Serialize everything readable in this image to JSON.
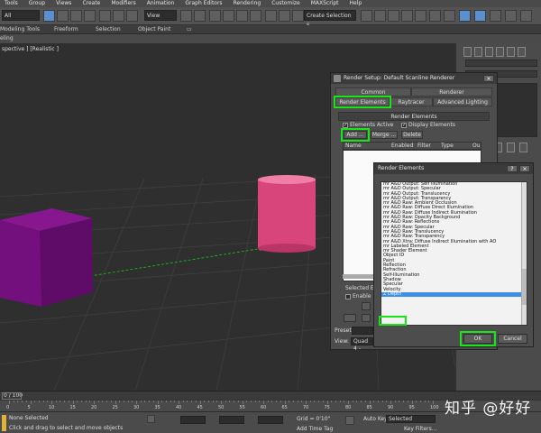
{
  "menu": [
    "Tools",
    "Group",
    "Views",
    "Create",
    "Modifiers",
    "Animation",
    "Graph Editors",
    "Rendering",
    "Customize",
    "MAXScript",
    "Help"
  ],
  "toolbar": {
    "selection_filter": "All",
    "ref_coord": "View",
    "named_selection": "Create Selection S"
  },
  "ribbon": {
    "tabs": [
      "Modeling Tools",
      "Freeform",
      "Selection",
      "Object Paint"
    ],
    "sub": "eling"
  },
  "viewport": {
    "label": "spective ] [Realistic ]"
  },
  "render_setup": {
    "title": "Render Setup: Default Scanline Renderer",
    "tabs_row1": [
      "Common",
      "Renderer"
    ],
    "tabs_row2": [
      "Render Elements",
      "Raytracer",
      "Advanced Lighting"
    ],
    "rollout_title": "Render Elements",
    "elements_active": "Elements Active",
    "display_elements": "Display Elements",
    "add_btn": "Add ...",
    "merge_btn": "Merge ...",
    "delete_btn": "Delete",
    "columns": [
      "Name",
      "Enabled",
      "Filter",
      "Type",
      "Ou"
    ],
    "selected_label": "Selected Ele",
    "enable_label": "Enable",
    "preset_label": "Preset:",
    "view_label": "View:",
    "view_value": "Quad 4 -"
  },
  "render_elements": {
    "title": "Render Elements",
    "items": [
      "mr A&D Output: Self Illumination",
      "mr A&D Output: Specular",
      "mr A&D Output: Translucency",
      "mr A&D Output: Transparency",
      "mr A&D Raw: Ambient Occlusion",
      "mr A&D Raw: Diffuse Direct Illumination",
      "mr A&D Raw: Diffuse Indirect Illumination",
      "mr A&D Raw: Opacity Background",
      "mr A&D Raw: Reflections",
      "mr A&D Raw: Specular",
      "mr A&D Raw: Translucency",
      "mr A&D Raw: Transparency",
      "mr A&D Xtra: Diffuse Indirect Illumination with AO",
      "mr Labeled Element",
      "mr Shader Element",
      "Object ID",
      "Paint",
      "Reflection",
      "Refraction",
      "Self-Illumination",
      "Shadow",
      "Specular",
      "Velocity",
      "Z Depth"
    ],
    "selected_index": 23,
    "ok_label": "OK",
    "cancel_label": "Cancel"
  },
  "timeline": {
    "frame": "0 / 100"
  },
  "trackbar_ticks": [
    "0",
    "5",
    "10",
    "15",
    "20",
    "25",
    "30",
    "35",
    "40",
    "45",
    "50",
    "55",
    "60",
    "65",
    "70",
    "75",
    "80",
    "85",
    "90",
    "95",
    "100"
  ],
  "status": {
    "selection": "None Selected",
    "prompt": "Click and drag to select and move objects",
    "grid": "Grid = 0'10\"",
    "add_time_tag": "Add Time Tag",
    "auto_key": "Auto Key",
    "selected": "Selected",
    "key_filters": "Key Filters..."
  },
  "watermark": "知乎 @好好",
  "colors": {
    "highlight_green": "#19e619",
    "selection_blue": "#3c8ee6",
    "cube": "#6e0d78",
    "cylinder": "#e0507a"
  }
}
